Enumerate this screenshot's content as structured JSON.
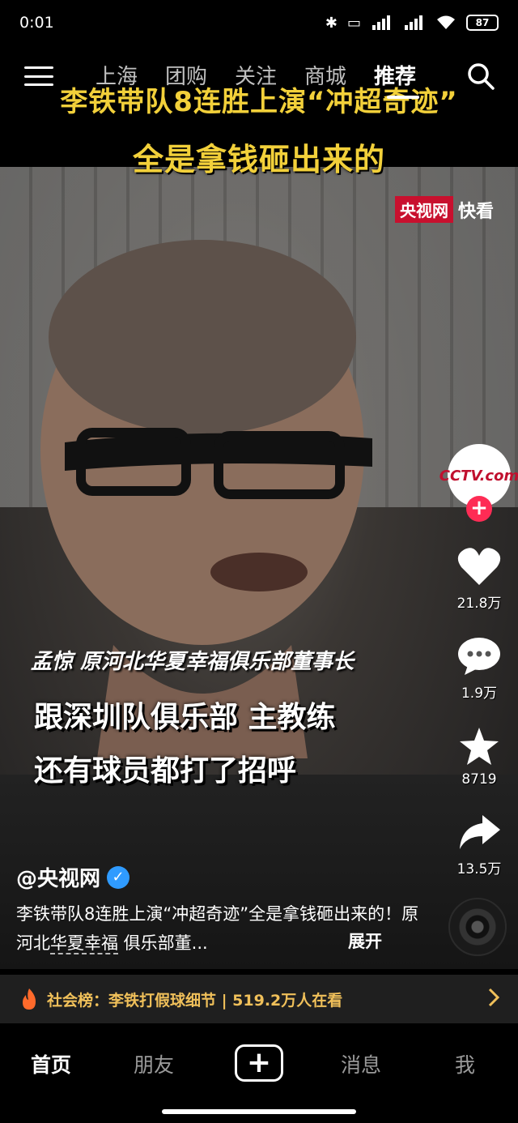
{
  "status_bar": {
    "time": "0:01",
    "battery": "87",
    "icons": [
      "bluetooth-icon",
      "vibrate-icon",
      "hd-signal-icon",
      "hd-signal-icon",
      "wifi-icon",
      "battery-icon"
    ]
  },
  "top_nav": {
    "tabs": [
      {
        "label": "上海",
        "active": false
      },
      {
        "label": "团购",
        "active": false
      },
      {
        "label": "关注",
        "active": false
      },
      {
        "label": "商城",
        "active": false
      },
      {
        "label": "推荐",
        "active": true
      }
    ]
  },
  "video": {
    "title_line1": "李铁带队8连胜上演“冲超奇迹”",
    "title_line2": "全是拿钱砸出来的",
    "watermark_brand": "央视网",
    "watermark_text": "快看",
    "speaker_caption": "孟惊  原河北华夏幸福俱乐部董事长",
    "caption_line1": "跟深圳队俱乐部  主教练",
    "caption_line2": "还有球员都打了招呼"
  },
  "right_rail": {
    "avatar_text": "CCTV.com",
    "follow": "+",
    "likes": "21.8万",
    "comments": "1.9万",
    "favorites": "8719",
    "shares": "13.5万"
  },
  "post": {
    "author": "@央视网",
    "description_part1": "李铁带队8连胜上演“冲超奇迹”全是拿钱砸出来的！原河北",
    "description_tag": "华夏幸福",
    "description_part2": " 俱乐部董...",
    "expand_label": "展开"
  },
  "hot_banner": {
    "text": "社会榜：李铁打假球细节 | 519.2万人在看"
  },
  "bottom_tabs": {
    "home": "首页",
    "friends": "朋友",
    "create": "+",
    "messages": "消息",
    "me": "我"
  },
  "colors": {
    "accent": "#fe2c55",
    "title_yellow": "#f2d03a",
    "banner_text": "#f0c05a",
    "verified": "#2f9bff"
  }
}
